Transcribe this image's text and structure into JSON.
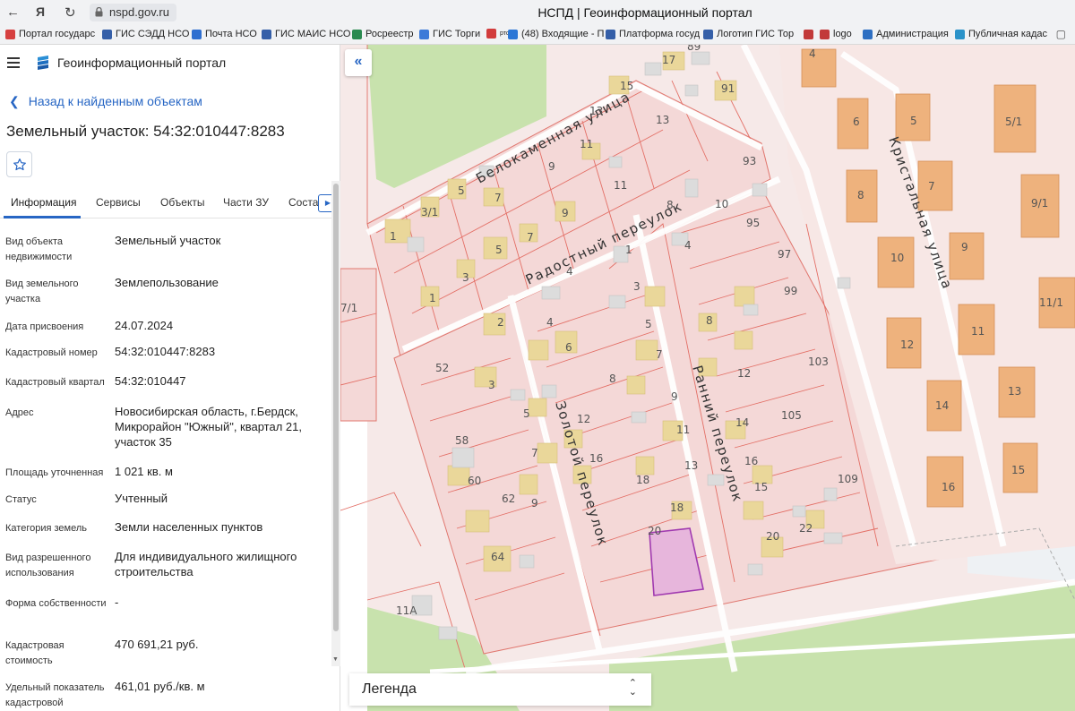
{
  "browser": {
    "url": "nspd.gov.ru",
    "tab_title": "НСПД | Геоинформационный портал",
    "bookmarks": [
      {
        "label": "Портал государс",
        "color": "#d64040"
      },
      {
        "label": "ГИС СЭДД НСО",
        "color": "#355fa8"
      },
      {
        "label": "Почта НСО",
        "color": "#2f6fd0"
      },
      {
        "label": "ГИС МАИС НСО",
        "color": "#355fa8"
      },
      {
        "label": "Росреестр",
        "color": "#2a8a50"
      },
      {
        "label": "ГИС Торги",
        "color": "#3d7ad8"
      },
      {
        "label": "ртс",
        "color": "#d23c3c"
      },
      {
        "label": "(48) Входящие - П",
        "color": "#2c77d6"
      },
      {
        "label": "Платформа госуд",
        "color": "#355fa8"
      },
      {
        "label": "Логотип ГИС Тор",
        "color": "#355fa8"
      },
      {
        "label": "logo",
        "color": "#c23a3a"
      },
      {
        "label": "Администрация",
        "color": "#2e6fc2"
      },
      {
        "label": "Публичная кадас",
        "color": "#2b93c9"
      }
    ]
  },
  "panel": {
    "portal_title": "Геоинформационный портал",
    "back_link": "Назад к найденным объектам",
    "object_title": "Земельный участок: 54:32:010447:8283",
    "tabs": [
      "Информация",
      "Сервисы",
      "Объекты",
      "Части ЗУ",
      "Соста"
    ],
    "active_tab": "Информация",
    "fields": [
      {
        "label": "Вид объекта недвижимости",
        "value": "Земельный участок"
      },
      {
        "label": "Вид земельного участка",
        "value": "Землепользование"
      },
      {
        "label": "Дата присвоения",
        "value": "24.07.2024"
      },
      {
        "label": "Кадастровый номер",
        "value": "54:32:010447:8283"
      },
      {
        "label": "Кадастровый квартал",
        "value": "54:32:010447"
      },
      {
        "label": "Адрес",
        "value": "Новосибирская область, г.Бердск, Микрорайон \"Южный\", квартал 21, участок 35"
      },
      {
        "label": "Площадь уточненная",
        "value": "1 021 кв. м"
      },
      {
        "label": "Статус",
        "value": "Учтенный"
      },
      {
        "label": "Категория земель",
        "value": "Земли населенных пунктов"
      },
      {
        "label": "Вид разрешенного использования",
        "value": "Для индивидуального жилищного строительства"
      },
      {
        "label": "Форма собственности",
        "value": "-"
      },
      {
        "label": "Кадастровая стоимость",
        "value": "470 691,21 руб."
      },
      {
        "label": "Удельный показатель кадастровой",
        "value": "461,01 руб./кв. м"
      }
    ]
  },
  "map": {
    "streets": [
      "Белокаменная улица",
      "Радостный переулок",
      "Кристальная улица",
      "Золотой переулок",
      "Ранний переулок"
    ],
    "parcel_numbers": [
      "89",
      "4",
      "17",
      "15",
      "91",
      "13",
      "6",
      "5",
      "5/1",
      "13",
      "11",
      "9",
      "93",
      "11",
      "3/1",
      "5",
      "7",
      "8",
      "10",
      "7",
      "8",
      "9/1",
      "9",
      "1",
      "7",
      "5",
      "4",
      "95",
      "1",
      "10",
      "9",
      "3",
      "1",
      "97",
      "4",
      "3",
      "99",
      "11/1",
      "7/1",
      "2",
      "4",
      "5",
      "8",
      "6",
      "12",
      "11",
      "52",
      "3",
      "7",
      "8",
      "103",
      "12",
      "9",
      "13",
      "58",
      "5",
      "12",
      "14",
      "14",
      "105",
      "7",
      "11",
      "16",
      "13",
      "60",
      "16",
      "18",
      "15",
      "62",
      "9",
      "18",
      "109",
      "16",
      "15",
      "20",
      "64",
      "22",
      "20",
      "11А"
    ],
    "accent_color": "#2766c4",
    "selected_parcel_color": "#a03ab0",
    "legend_label": "Легенда"
  }
}
